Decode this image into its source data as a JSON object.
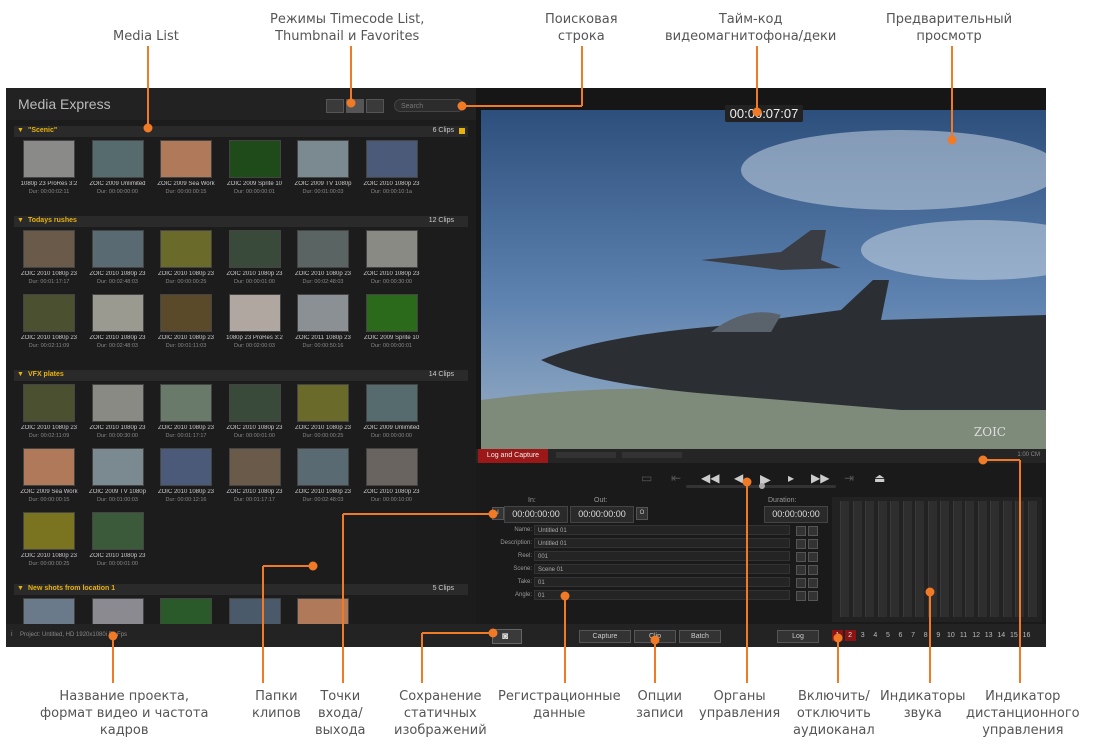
{
  "callouts": [
    {
      "id": "media-list",
      "text": "Media List"
    },
    {
      "id": "modes",
      "text": "Режимы Timecode List,\nThumbnail и Favorites"
    },
    {
      "id": "search-row",
      "text": "Поисковая\nстрока"
    },
    {
      "id": "vtr-timecode",
      "text": "Тайм-код\nвидеомагнитофона/деки"
    },
    {
      "id": "preview",
      "text": "Предварительный\nпросмотр"
    },
    {
      "id": "project",
      "text": "Название проекта,\nформат видео и частота\nкадров"
    },
    {
      "id": "bins",
      "text": "Папки\nклипов"
    },
    {
      "id": "inout",
      "text": "Точки\nвхода/\nвыхода"
    },
    {
      "id": "stills",
      "text": "Сохранение\nстатичных\nизображений"
    },
    {
      "id": "logging",
      "text": "Регистрационные\nданные"
    },
    {
      "id": "record-opts",
      "text": "Опции\nзаписи"
    },
    {
      "id": "controls",
      "text": "Органы\nуправления"
    },
    {
      "id": "audio-toggle",
      "text": "Включить/\nотключить\nаудиоканал"
    },
    {
      "id": "audio-meters",
      "text": "Индикаторы\nзвука"
    },
    {
      "id": "remote",
      "text": "Индикатор\nдистанционного\nуправления"
    }
  ],
  "app": {
    "title": "Media Express",
    "search_placeholder": "Search"
  },
  "bins": [
    {
      "name": "\"Scenic\"",
      "count": "6 Clips",
      "clips": [
        {
          "name": "1080p 23 ProRes 3:2",
          "dur": "Dur: 00:00:02:11",
          "color": "#8a8a88"
        },
        {
          "name": "ZOIC 2009 Unlimited",
          "dur": "Dur: 00:00:00:00",
          "color": "#556b6e"
        },
        {
          "name": "ZOIC 2009 Sea Work",
          "dur": "Dur: 00:00:00:15",
          "color": "#b07a5a"
        },
        {
          "name": "ZOIC 2009 Sprite 10",
          "dur": "Dur: 00:00:00:01",
          "color": "#1f4a1a"
        },
        {
          "name": "ZOIC 2009 TV 1080p",
          "dur": "Dur: 00:01:00:03",
          "color": "#7a8a90"
        },
        {
          "name": "ZOIC 2010 1080p 23",
          "dur": "Dur: 00:00:10:1a",
          "color": "#4a5a78"
        }
      ]
    },
    {
      "name": "Todays rushes",
      "count": "12 Clips",
      "clips": [
        {
          "name": "ZOIC 2010 1080p 23",
          "dur": "Dur: 00:01:17:17",
          "color": "#6a5a4a"
        },
        {
          "name": "ZOIC 2010 1080p 23",
          "dur": "Dur: 00:02:48:03",
          "color": "#5a6a72"
        },
        {
          "name": "ZOIC 2010 1080p 23",
          "dur": "Dur: 00:00:00:25",
          "color": "#6a6a2a"
        },
        {
          "name": "ZOIC 2010 1080p 23",
          "dur": "Dur: 00:00:01:00",
          "color": "#3a4a3a"
        },
        {
          "name": "ZOIC 2010 1080p 23",
          "dur": "Dur: 00:02:48:03",
          "color": "#5a6462"
        },
        {
          "name": "ZOIC 2010 1080p 23",
          "dur": "Dur: 00:00:30:00",
          "color": "#8a8a84"
        },
        {
          "name": "ZOIC 2010 1080p 23",
          "dur": "Dur: 00:02:11:09",
          "color": "#4a5030"
        },
        {
          "name": "ZOIC 2010 1080p 23",
          "dur": "Dur: 00:02:48:03",
          "color": "#9a9a90"
        },
        {
          "name": "ZOIC 2010 1080p 23",
          "dur": "Dur: 00:01:11:03",
          "color": "#5a4a2a"
        },
        {
          "name": "1080p 23 ProRes 3:2",
          "dur": "Dur: 00:02:00:03",
          "color": "#b0a8a0"
        },
        {
          "name": "ZOIC 2011 1080p 23",
          "dur": "Dur: 00:00:50:16",
          "color": "#8a9094"
        },
        {
          "name": "ZOIC 2009 Sprite 10",
          "dur": "Dur: 00:00:00:01",
          "color": "#2a6a1a"
        }
      ]
    },
    {
      "name": "VFX plates",
      "count": "14 Clips",
      "clips": [
        {
          "name": "ZOIC 2010 1080p 23",
          "dur": "Dur: 00:02:11:09",
          "color": "#4a5030"
        },
        {
          "name": "ZOIC 2010 1080p 23",
          "dur": "Dur: 00:00:30:00",
          "color": "#8a8a84"
        },
        {
          "name": "ZOIC 2010 1080p 23",
          "dur": "Dur: 00:01:17:17",
          "color": "#6a7a6a"
        },
        {
          "name": "ZOIC 2010 1080p 23",
          "dur": "Dur: 00:00:01:00",
          "color": "#3a4a3a"
        },
        {
          "name": "ZOIC 2010 1080p 23",
          "dur": "Dur: 00:00:00:25",
          "color": "#6a6a2a"
        },
        {
          "name": "ZOIC 2009 Unlimited",
          "dur": "Dur: 00:00:00:00",
          "color": "#556b6e"
        },
        {
          "name": "ZOIC 2009 Sea Work",
          "dur": "Dur: 00:00:00:15",
          "color": "#b07a5a"
        },
        {
          "name": "ZOIC 2009 TV 1080p",
          "dur": "Dur: 00:01:00:03",
          "color": "#7a8a90"
        },
        {
          "name": "ZOIC 2010 1080p 23",
          "dur": "Dur: 00:00:12:16",
          "color": "#4a5a78"
        },
        {
          "name": "ZOIC 2010 1080p 23",
          "dur": "Dur: 00:01:17:17",
          "color": "#6a5a4a"
        },
        {
          "name": "ZOIC 2010 1080p 23",
          "dur": "Dur: 00:02:48:03",
          "color": "#5a6a72"
        },
        {
          "name": "ZOIC 2010 1080p 23",
          "dur": "Dur: 00:00:10:00",
          "color": "#6a6460"
        },
        {
          "name": "ZOIC 2010 1080p 23",
          "dur": "Dur: 00:00:00:25",
          "color": "#7a7420"
        },
        {
          "name": "ZOIC 2010 1080p 23",
          "dur": "Dur: 00:00:01:00",
          "color": "#3a5a3a"
        }
      ]
    },
    {
      "name": "New shots from location 1",
      "count": "5 Clips",
      "clips": [
        {
          "name": "",
          "dur": "",
          "color": "#6a7a8a"
        },
        {
          "name": "",
          "dur": "",
          "color": "#8a8a90"
        },
        {
          "name": "",
          "dur": "",
          "color": "#2a5a2a"
        },
        {
          "name": "",
          "dur": "",
          "color": "#4a5a6a"
        },
        {
          "name": "",
          "dur": "",
          "color": "#b07a5a"
        }
      ]
    }
  ],
  "preview": {
    "timecode": "00:00:07:07",
    "watermark": "ZOIC"
  },
  "panel": {
    "active_tab": "Log and Capture",
    "remote": "1:00 CM",
    "in_label": "In:",
    "out_label": "Out:",
    "duration_label": "Duration:",
    "in_tc": "00:00:00:00",
    "out_tc": "00:00:00:00",
    "duration_tc": "00:00:00:00",
    "fields": [
      {
        "label": "Name:",
        "value": "Untitled 01"
      },
      {
        "label": "Description:",
        "value": "Untitled 01"
      },
      {
        "label": "Reel:",
        "value": "001"
      },
      {
        "label": "Scene:",
        "value": "Scene 01"
      },
      {
        "label": "Take:",
        "value": "01"
      },
      {
        "label": "Angle:",
        "value": "01"
      }
    ]
  },
  "status": {
    "project": "Project: Untitled, HD 1920x1080i 50 Fps",
    "capture": "Capture",
    "clip": "Clip",
    "batch": "Batch",
    "log": "Log",
    "channels": [
      "1",
      "2",
      "3",
      "4",
      "5",
      "6",
      "7",
      "8",
      "9",
      "10",
      "11",
      "12",
      "13",
      "14",
      "15",
      "16"
    ]
  },
  "colors": {
    "accent_red": "#9c1818",
    "bin_yellow": "#e8b20e",
    "callout_line": "#f07a26"
  }
}
